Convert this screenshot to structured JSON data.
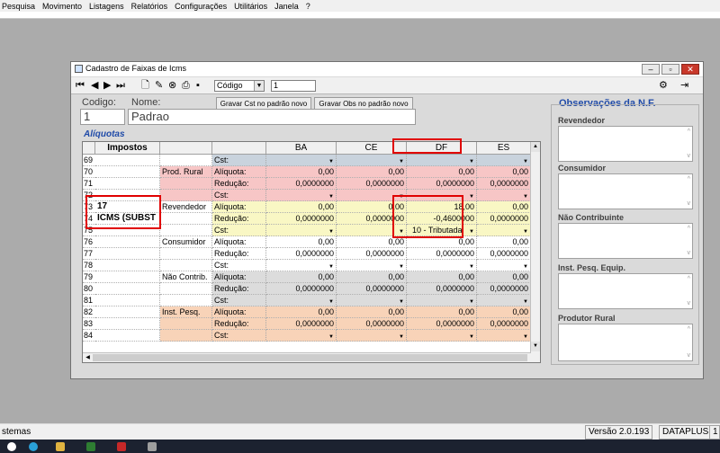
{
  "menu": [
    "Pesquisa",
    "Movimento",
    "Listagens",
    "Relatórios",
    "Configurações",
    "Utilitários",
    "Janela",
    "?"
  ],
  "window": {
    "title": "Cadastro de Faixas de Icms"
  },
  "toolbar": {
    "order_combo": "Código",
    "search_value": "1",
    "nav_first": "⏮",
    "nav_prev": "◀",
    "nav_next": "▶",
    "nav_last": "⏭"
  },
  "form": {
    "codigo_label": "Codigo:",
    "nome_label": "Nome:",
    "codigo_value": "1",
    "nome_value": "Padrao",
    "btn_gravar_cst": "Gravar Cst no padrão novo",
    "btn_gravar_obs": "Gravar Obs no padrão novo"
  },
  "aliquotas_label": "Alíquotas",
  "grid": {
    "headers": [
      "Impostos",
      "",
      "",
      "BA",
      "CE",
      "DF",
      "ES"
    ],
    "rows": [
      {
        "n": "69",
        "imp": "",
        "cat": "",
        "sub": "Cst:",
        "ba": "",
        "ce": "",
        "df": "",
        "es": "",
        "dd": true,
        "bg": "#c9d3dd"
      },
      {
        "n": "70",
        "imp": "",
        "cat": "Prod. Rural",
        "sub": "Alíquota:",
        "ba": "0,00",
        "ce": "0,00",
        "df": "0,00",
        "es": "0,00",
        "bg": "#f7c6c6"
      },
      {
        "n": "71",
        "imp": "",
        "cat": "",
        "sub": "Redução:",
        "ba": "0,0000000",
        "ce": "0,0000000",
        "df": "0,0000000",
        "es": "0,0000000",
        "bg": "#f7c6c6"
      },
      {
        "n": "72",
        "imp": "",
        "cat": "",
        "sub": "Cst:",
        "ba": "",
        "ce": "",
        "df": "",
        "es": "",
        "dd": true,
        "bg": "#f7c6c6"
      },
      {
        "n": "73",
        "imp": "17",
        "cat": "Revendedor",
        "sub": "Alíquota:",
        "ba": "0,00",
        "ce": "0,00",
        "df": "18,00",
        "es": "0,00",
        "bg": "#f9f7c4"
      },
      {
        "n": "74",
        "imp": "ICMS (SUBST",
        "cat": "",
        "sub": "Redução:",
        "ba": "0,0000000",
        "ce": "0,0000000",
        "df": "-0,4600000",
        "es": "0,0000000",
        "bg": "#f9f7c4"
      },
      {
        "n": "75",
        "imp": "",
        "cat": "",
        "sub": "Cst:",
        "ba": "",
        "ce": "",
        "df": "10 - Tributada",
        "es": "",
        "dd": true,
        "bg": "#f9f7c4"
      },
      {
        "n": "76",
        "imp": "",
        "cat": "Consumidor",
        "sub": "Alíquota:",
        "ba": "0,00",
        "ce": "0,00",
        "df": "0,00",
        "es": "0,00",
        "bg": "#ffffff"
      },
      {
        "n": "77",
        "imp": "",
        "cat": "",
        "sub": "Redução:",
        "ba": "0,0000000",
        "ce": "0,0000000",
        "df": "0,0000000",
        "es": "0,0000000",
        "bg": "#ffffff"
      },
      {
        "n": "78",
        "imp": "",
        "cat": "",
        "sub": "Cst:",
        "ba": "",
        "ce": "",
        "df": "",
        "es": "",
        "dd": true,
        "bg": "#ffffff"
      },
      {
        "n": "79",
        "imp": "",
        "cat": "Não Contrib.",
        "sub": "Alíquota:",
        "ba": "0,00",
        "ce": "0,00",
        "df": "0,00",
        "es": "0,00",
        "bg": "#dcdcdc"
      },
      {
        "n": "80",
        "imp": "",
        "cat": "",
        "sub": "Redução:",
        "ba": "0,0000000",
        "ce": "0,0000000",
        "df": "0,0000000",
        "es": "0,0000000",
        "bg": "#dcdcdc"
      },
      {
        "n": "81",
        "imp": "",
        "cat": "",
        "sub": "Cst:",
        "ba": "",
        "ce": "",
        "df": "",
        "es": "",
        "dd": true,
        "bg": "#dcdcdc"
      },
      {
        "n": "82",
        "imp": "",
        "cat": "Inst. Pesq.",
        "sub": "Alíquota:",
        "ba": "0,00",
        "ce": "0,00",
        "df": "0,00",
        "es": "0,00",
        "bg": "#f8d3b8"
      },
      {
        "n": "83",
        "imp": "",
        "cat": "",
        "sub": "Redução:",
        "ba": "0,0000000",
        "ce": "0,0000000",
        "df": "0,0000000",
        "es": "0,0000000",
        "bg": "#f8d3b8"
      },
      {
        "n": "84",
        "imp": "",
        "cat": "",
        "sub": "Cst:",
        "ba": "",
        "ce": "",
        "df": "",
        "es": "",
        "dd": true,
        "bg": "#f8d3b8"
      }
    ]
  },
  "observacoes": {
    "title": "Observações da N.F.",
    "sections": [
      "Revendedor",
      "Consumidor",
      "Não Contribuinte",
      "Inst. Pesq. Equip.",
      "Produtor Rural"
    ]
  },
  "status": {
    "left": "stemas",
    "version": "Versão 2.0.193",
    "company": "DATAPLUS",
    "extra": "1"
  },
  "colors": {
    "accent": "#1f4aa8",
    "highlight": "#e00000"
  }
}
